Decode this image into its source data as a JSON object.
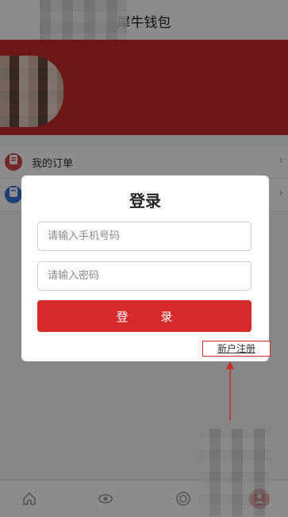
{
  "header": {
    "title": "犀牛钱包"
  },
  "list": {
    "items": [
      {
        "label": "我的订单",
        "icon": "order-icon",
        "color": "#d64545"
      },
      {
        "label": "",
        "icon": "document-icon",
        "color": "#3a6fd8"
      }
    ]
  },
  "modal": {
    "title": "登录",
    "phone_placeholder": "请输入手机号码",
    "password_placeholder": "请输入密码",
    "login_label": "登 录",
    "register_label": "新户注册"
  },
  "tabbar": {
    "tabs": [
      {
        "icon": "home-icon"
      },
      {
        "icon": "eye-icon"
      },
      {
        "icon": "coin-icon"
      },
      {
        "icon": "user-icon",
        "active": true
      }
    ]
  },
  "colors": {
    "accent": "#d62b2b",
    "banner": "#c92b2b"
  }
}
